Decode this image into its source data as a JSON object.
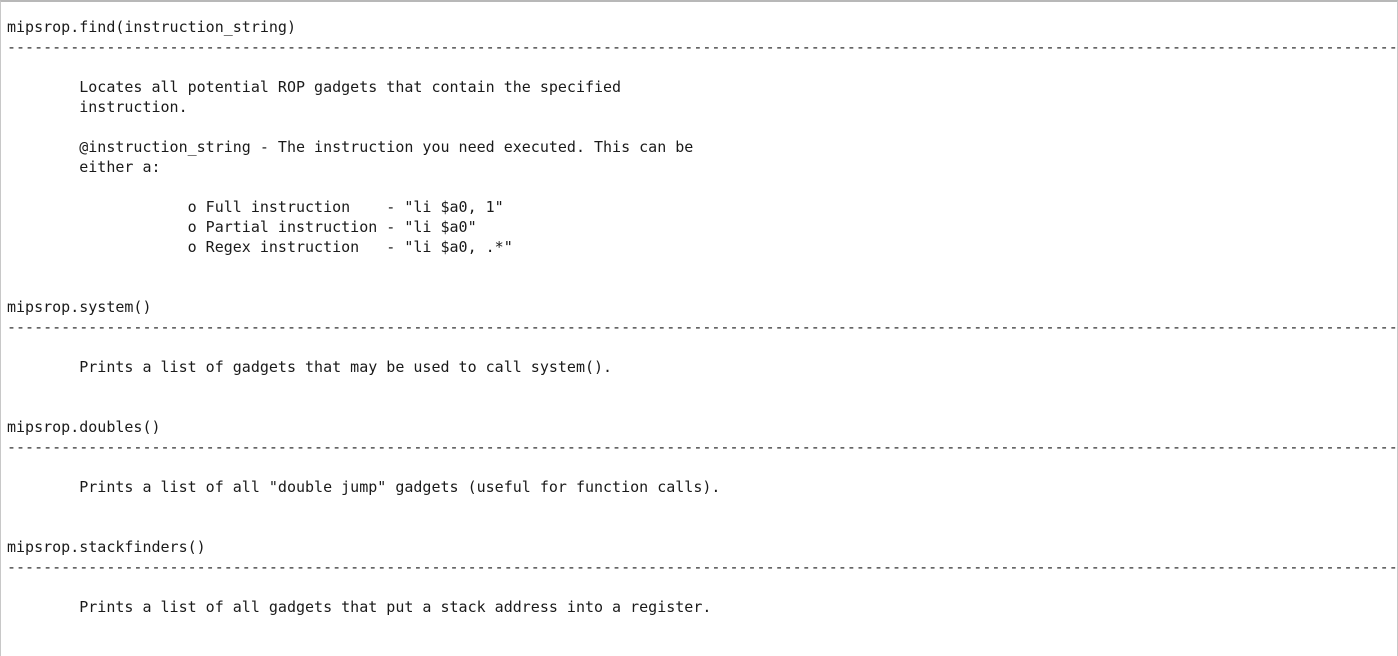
{
  "document": {
    "lines": [
      "mipsrop.find(instruction_string)",
      "---------------------------------------------------------------------------------------------------------------------------------------------------------------",
      "",
      "        Locates all potential ROP gadgets that contain the specified",
      "        instruction.",
      "",
      "        @instruction_string - The instruction you need executed. This can be",
      "        either a:",
      "",
      "                    o Full instruction    - \"li $a0, 1\"",
      "                    o Partial instruction - \"li $a0\"",
      "                    o Regex instruction   - \"li $a0, .*\"",
      "",
      "",
      "mipsrop.system()",
      "---------------------------------------------------------------------------------------------------------------------------------------------------------------",
      "",
      "        Prints a list of gadgets that may be used to call system().",
      "",
      "",
      "mipsrop.doubles()",
      "---------------------------------------------------------------------------------------------------------------------------------------------------------------",
      "",
      "        Prints a list of all \"double jump\" gadgets (useful for function calls).",
      "",
      "",
      "mipsrop.stackfinders()",
      "---------------------------------------------------------------------------------------------------------------------------------------------------------------",
      "",
      "        Prints a list of all gadgets that put a stack address into a register.",
      ""
    ]
  }
}
